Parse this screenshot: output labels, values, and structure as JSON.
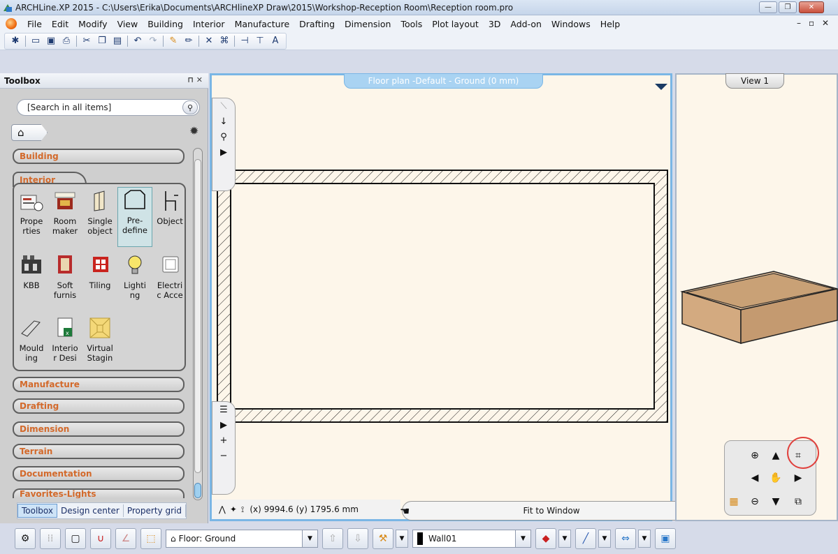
{
  "window": {
    "title": "ARCHLine.XP 2015 - C:\\Users\\Erika\\Documents\\ARCHlineXP Draw\\2015\\Workshop-Reception Room\\Reception room.pro"
  },
  "menu": {
    "items": [
      "File",
      "Edit",
      "Modify",
      "View",
      "Building",
      "Interior",
      "Manufacture",
      "Drafting",
      "Dimension",
      "Tools",
      "Plot layout",
      "3D",
      "Add-on",
      "Windows",
      "Help"
    ]
  },
  "toolbox": {
    "title": "Toolbox",
    "search_placeholder": "[Search in all items]",
    "categories": {
      "building": "Building",
      "interior": "Interior",
      "manufacture": "Manufacture",
      "drafting": "Drafting",
      "dimension": "Dimension",
      "terrain": "Terrain",
      "documentation": "Documentation",
      "favorites": "Favorites-Lights"
    },
    "tools": [
      {
        "label": "Prope\nrties",
        "icon": "properties-icon"
      },
      {
        "label": "Room\nmaker",
        "icon": "room-maker-icon"
      },
      {
        "label": "Single\nobject",
        "icon": "single-object-icon"
      },
      {
        "label": "Pre-\ndefine",
        "icon": "predefine-icon"
      },
      {
        "label": "Object",
        "icon": "object-chair-icon"
      },
      {
        "label": "KBB",
        "icon": "kbb-icon"
      },
      {
        "label": "Soft\nfurnis",
        "icon": "soft-furnishing-icon"
      },
      {
        "label": "Tiling",
        "icon": "tiling-icon"
      },
      {
        "label": "Lighti\nng",
        "icon": "lightbulb-icon"
      },
      {
        "label": "Electri\nc Acce",
        "icon": "electric-icon"
      },
      {
        "label": "Mould\ning",
        "icon": "moulding-icon"
      },
      {
        "label": "Interio\nr Desi",
        "icon": "interior-design-icon"
      },
      {
        "label": "Virtual\nStagin",
        "icon": "virtual-staging-icon"
      }
    ],
    "bottom_tabs": [
      "Toolbox",
      "Design center",
      "Property grid"
    ]
  },
  "plan": {
    "title": "Floor plan -Default - Ground (0 mm)",
    "coords": "(x) 9994.6  (y) 1795.6 mm",
    "fit_label": "Fit to Window"
  },
  "view3d": {
    "title": "View 1"
  },
  "bottombar": {
    "floor_label": "Floor: Ground",
    "wall_label": "Wall01"
  },
  "colors": {
    "accent_blue": "#7ab6e5",
    "category_orange": "#d3692a",
    "highlight_red": "#e0413d"
  }
}
